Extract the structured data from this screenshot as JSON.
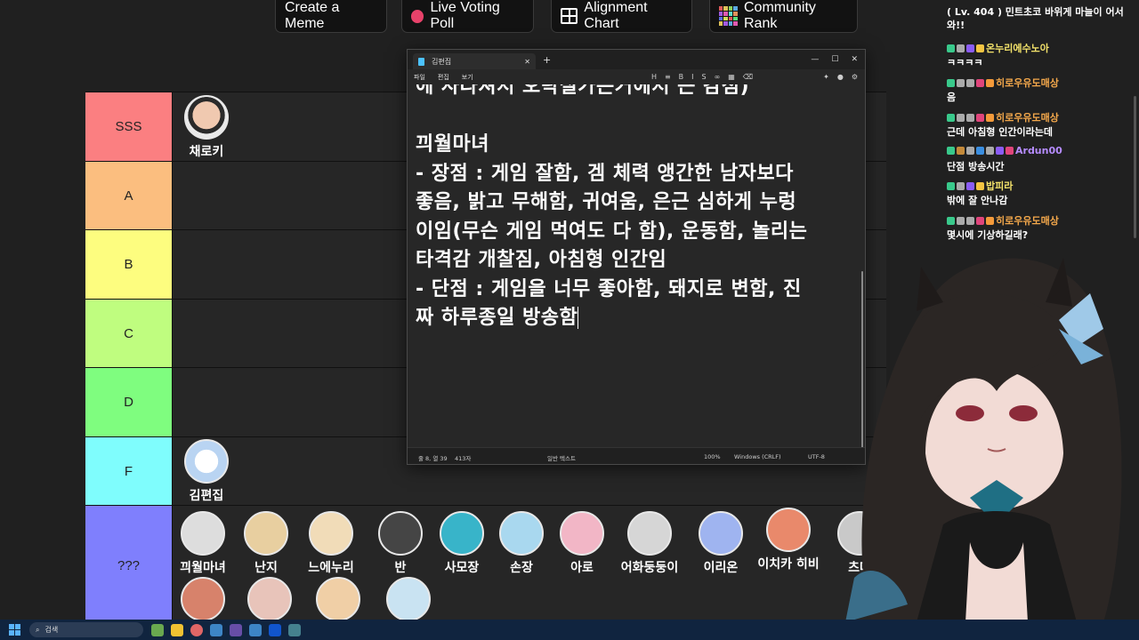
{
  "toolbar": {
    "buttons": [
      {
        "label": "Create a Meme",
        "icon": "none"
      },
      {
        "label": "Live Voting Poll",
        "icon": "record-dot-icon"
      },
      {
        "label": "Alignment Chart",
        "icon": "grid-icon"
      },
      {
        "label": "Community Rank",
        "icon": "mosaic-icon"
      }
    ]
  },
  "tiers": [
    {
      "label": "SSS",
      "color": "#fb7f81",
      "members": [
        "채로키"
      ]
    },
    {
      "label": "A",
      "color": "#fbbe7f",
      "members": []
    },
    {
      "label": "B",
      "color": "#fdfd7f",
      "members": []
    },
    {
      "label": "C",
      "color": "#bffd7f",
      "members": []
    },
    {
      "label": "D",
      "color": "#7ffd7f",
      "members": []
    },
    {
      "label": "F",
      "color": "#7ffdfd",
      "members": [
        "김편집"
      ]
    },
    {
      "label": "???",
      "color": "#7f7ffd",
      "members": [
        "끠월마녀",
        "난지",
        "느에누리",
        "반",
        "사모장",
        "손장",
        "아로",
        "어화둥둥이",
        "이리온",
        "이치카 히비",
        "츠먀"
      ]
    }
  ],
  "notepad": {
    "tab_title": "김편집",
    "menu": [
      "파일",
      "편집",
      "보기"
    ],
    "lines": [
      "에 사라져서 오락실가는거에서 큰 감점)",
      "",
      "끠월마녀",
      "- 장점 : 게임 잘함, 겜 체력 앵간한 남자보다",
      "좋음, 밝고 무해함, 귀여움, 은근 심하게 누렁",
      "이임(무슨 게임 먹여도 다 함), 운동함, 놀리는",
      "타격감 개찰짐, 아침형 인간임",
      "- 단점 : 게임을 너무 좋아함, 돼지로 변함, 진",
      "짜 하루종일 방송함"
    ],
    "status": {
      "position": "줄 8, 열 39",
      "chars": "413자",
      "format": "일반 텍스트",
      "zoom": "100%",
      "line_ending": "Windows (CRLF)",
      "encoding": "UTF-8"
    }
  },
  "chat": {
    "messages": [
      {
        "user": "",
        "text": "( Lv. 404 ) 민트초코 바위게 마늘이 어서 와!!",
        "user_color": "#ffffff"
      },
      {
        "user": "온누리에수노아",
        "text": "ㅋㅋㅋㅋ",
        "user_color": "#f4e36b"
      },
      {
        "user": "히로우유도매상",
        "text": "음",
        "user_color": "#f4a84b"
      },
      {
        "user": "히로우유도매상",
        "text": "근데 아침형 인간이라는데",
        "user_color": "#f4a84b"
      },
      {
        "user": "Ardun00",
        "text": "단점 방송시간",
        "user_color": "#b68cff"
      },
      {
        "user": "밥피라",
        "text": "밖에 잘 안나감",
        "user_color": "#f4e36b"
      },
      {
        "user": "히로우유도매상",
        "text": "몇시에 기상하길래?",
        "user_color": "#f4a84b"
      }
    ]
  },
  "taskbar": {
    "search_placeholder": "검색"
  }
}
